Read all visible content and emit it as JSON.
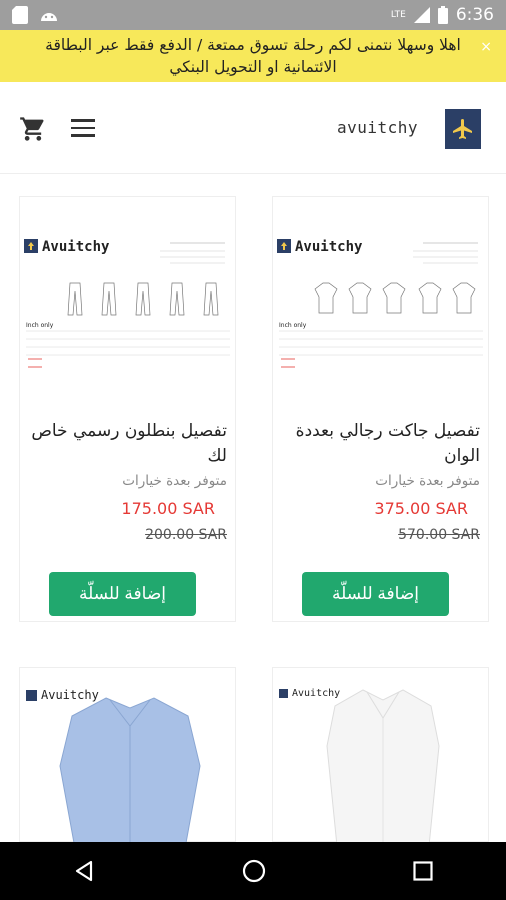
{
  "status": {
    "time": "6:36",
    "network": "LTE"
  },
  "announcement": {
    "text": "اهلا وسهلا نتمنى لكم رحلة تسوق ممتعة / الدفع فقط عبر البطاقة الائتمانية او التحويل البنكي",
    "close": "×"
  },
  "header": {
    "brand": "avuitchy"
  },
  "products": [
    {
      "title": "تفصيل جاكت رجالي بعددة الوان",
      "availability": "متوفر بعدة خيارات",
      "price": "375.00 SAR",
      "old_price": "570.00 SAR",
      "button": "إضافة للسلّة",
      "brand": "Avuitchy"
    },
    {
      "title": "تفصيل بنطلون رسمي خاص لك",
      "availability": "متوفر بعدة خيارات",
      "price": "175.00 SAR",
      "old_price": "200.00 SAR",
      "button": "إضافة للسلّة",
      "brand": "Avuitchy"
    },
    {
      "brand": "Avuitchy"
    },
    {
      "brand": "Avuitchy"
    }
  ],
  "colors": {
    "accent": "#21a86e",
    "price": "#e53935",
    "banner": "#f7e85a",
    "logo_bg": "#2b3f66"
  },
  "icons": [
    "cart-icon",
    "menu-icon",
    "plane-logo-icon",
    "back-icon",
    "home-icon",
    "recents-icon"
  ]
}
